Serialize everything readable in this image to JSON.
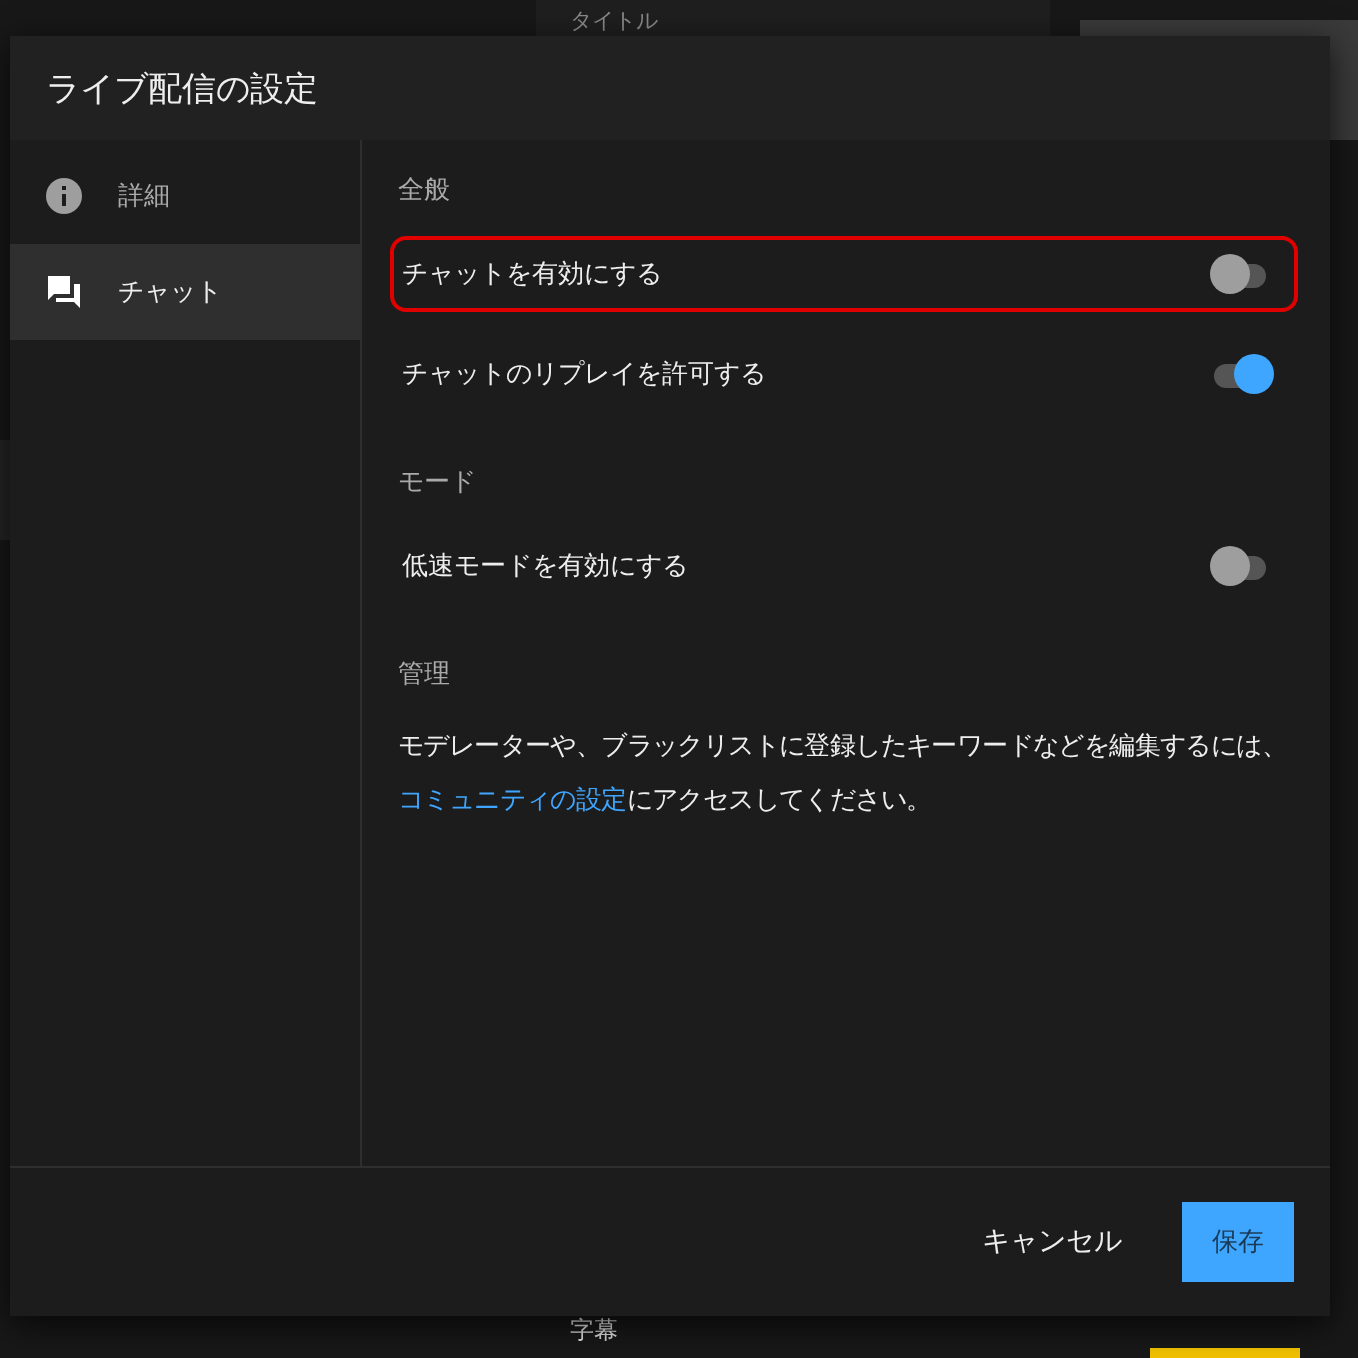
{
  "background": {
    "top_label": "タイトル",
    "bottom_label": "字幕"
  },
  "dialog": {
    "title": "ライブ配信の設定",
    "sidebar": {
      "items": [
        {
          "label": "詳細",
          "kind": "info",
          "selected": false
        },
        {
          "label": "チャット",
          "kind": "chat",
          "selected": true
        }
      ]
    },
    "sections": [
      {
        "heading": "全般",
        "settings": [
          {
            "label": "チャットを有効にする",
            "on": false,
            "highlighted": true
          },
          {
            "label": "チャットのリプレイを許可する",
            "on": true,
            "highlighted": false
          }
        ]
      },
      {
        "heading": "モード",
        "settings": [
          {
            "label": "低速モードを有効にする",
            "on": false,
            "highlighted": false
          }
        ]
      },
      {
        "heading": "管理",
        "text_before": "モデレーターや、ブラックリストに登録したキーワードなどを編集するには、",
        "link": "コミュニティの設定",
        "text_after": "にアクセスしてください。"
      }
    ],
    "buttons": {
      "cancel": "キャンセル",
      "save": "保存"
    }
  }
}
